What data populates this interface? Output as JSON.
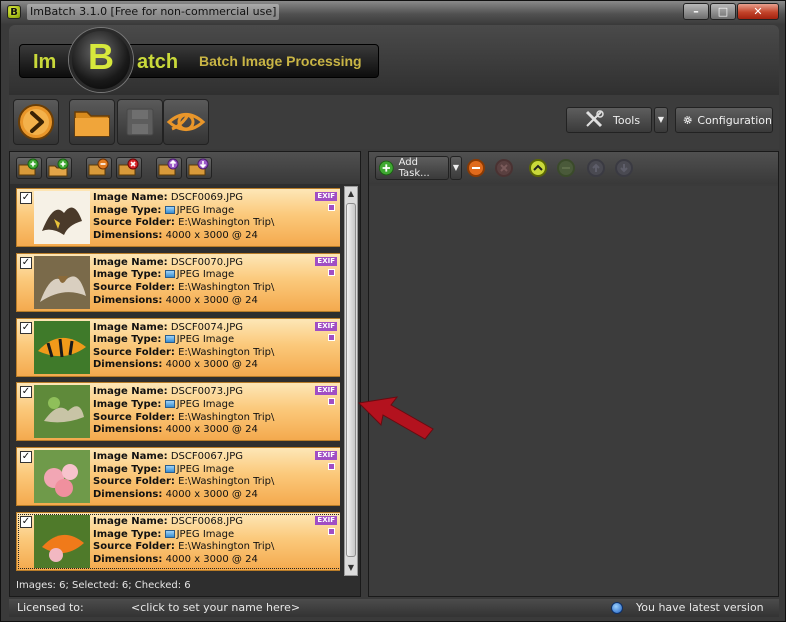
{
  "window": {
    "title": "ImBatch 3.1.0 [Free for non-commercial use]",
    "app_icon_glyph": "B",
    "controls": [
      "minimize",
      "maximize",
      "close"
    ]
  },
  "banner": {
    "logo_left": "Im",
    "logo_center": "B",
    "logo_right": "atch",
    "tagline": "Batch Image Processing"
  },
  "toolbar": {
    "tools_label": "Tools",
    "configuration_label": "Configuration"
  },
  "images": [
    {
      "name": "DSCF0069.JPG",
      "type": "JPEG Image",
      "folder": "E:\\Washington Trip\\",
      "dimensions": "4000 x 3000 @ 24",
      "checked": true,
      "selected": false
    },
    {
      "name": "DSCF0070.JPG",
      "type": "JPEG Image",
      "folder": "E:\\Washington Trip\\",
      "dimensions": "4000 x 3000 @ 24",
      "checked": true,
      "selected": false
    },
    {
      "name": "DSCF0074.JPG",
      "type": "JPEG Image",
      "folder": "E:\\Washington Trip\\",
      "dimensions": "4000 x 3000 @ 24",
      "checked": true,
      "selected": false
    },
    {
      "name": "DSCF0073.JPG",
      "type": "JPEG Image",
      "folder": "E:\\Washington Trip\\",
      "dimensions": "4000 x 3000 @ 24",
      "checked": true,
      "selected": false
    },
    {
      "name": "DSCF0067.JPG",
      "type": "JPEG Image",
      "folder": "E:\\Washington Trip\\",
      "dimensions": "4000 x 3000 @ 24",
      "checked": true,
      "selected": false
    },
    {
      "name": "DSCF0068.JPG",
      "type": "JPEG Image",
      "folder": "E:\\Washington Trip\\",
      "dimensions": "4000 x 3000 @ 24",
      "checked": true,
      "selected": true
    }
  ],
  "card_labels": {
    "name": "Image Name:",
    "type": "Image Type:",
    "folder": "Source Folder:",
    "dimensions": "Dimensions:",
    "exif": "EXIF"
  },
  "image_status": "Images: 6; Selected: 6; Checked: 6",
  "tasks": {
    "add_task_label": "Add Task..."
  },
  "statusbar": {
    "licensed_label": "Licensed to:",
    "licensed_value": "<click to set your name here>",
    "version_text": "You have latest version"
  },
  "colors": {
    "card_top": "#fde7b7",
    "card_bottom": "#f4aa4e",
    "logo_accent": "#c9d93a",
    "annotation_arrow": "#b3121e"
  }
}
